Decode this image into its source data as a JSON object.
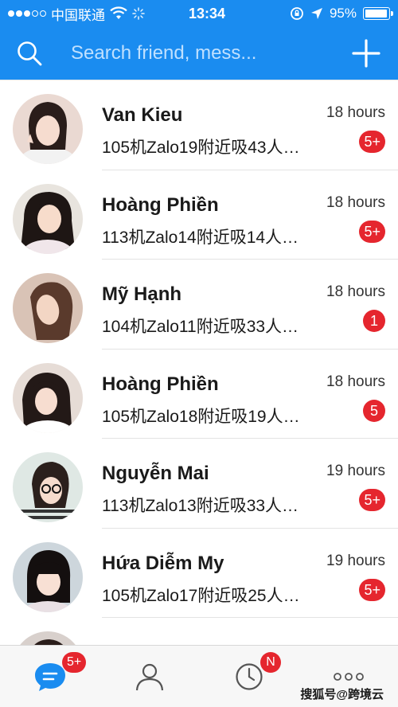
{
  "status_bar": {
    "carrier": "中国联通",
    "time": "13:34",
    "battery": "95%",
    "battery_level": 0.95
  },
  "search": {
    "placeholder": "Search friend, mess..."
  },
  "chats": [
    {
      "name": "Van Kieu",
      "preview": "105机Zalo19附近吸43人…",
      "time": "18 hours",
      "badge": "5+"
    },
    {
      "name": "Hoàng Phiền",
      "preview": "113机Zalo14附近吸14人…",
      "time": "18 hours",
      "badge": "5+"
    },
    {
      "name": "Mỹ Hạnh",
      "preview": "104机Zalo11附近吸33人…",
      "time": "18 hours",
      "badge": "1"
    },
    {
      "name": "Hoàng Phiền",
      "preview": "105机Zalo18附近吸19人…",
      "time": "18 hours",
      "badge": "5"
    },
    {
      "name": "Nguyễn Mai",
      "preview": "113机Zalo13附近吸33人…",
      "time": "19 hours",
      "badge": "5+"
    },
    {
      "name": "Hứa Diễm My",
      "preview": "105机Zalo17附近吸25人…",
      "time": "19 hours",
      "badge": "5+"
    }
  ],
  "tab_bar": {
    "messages_badge": "5+",
    "timeline_badge": "N",
    "watermark": "搜狐号@跨境云"
  },
  "colors": {
    "brand_blue": "#1a8cf0",
    "badge_red": "#e5262e"
  }
}
